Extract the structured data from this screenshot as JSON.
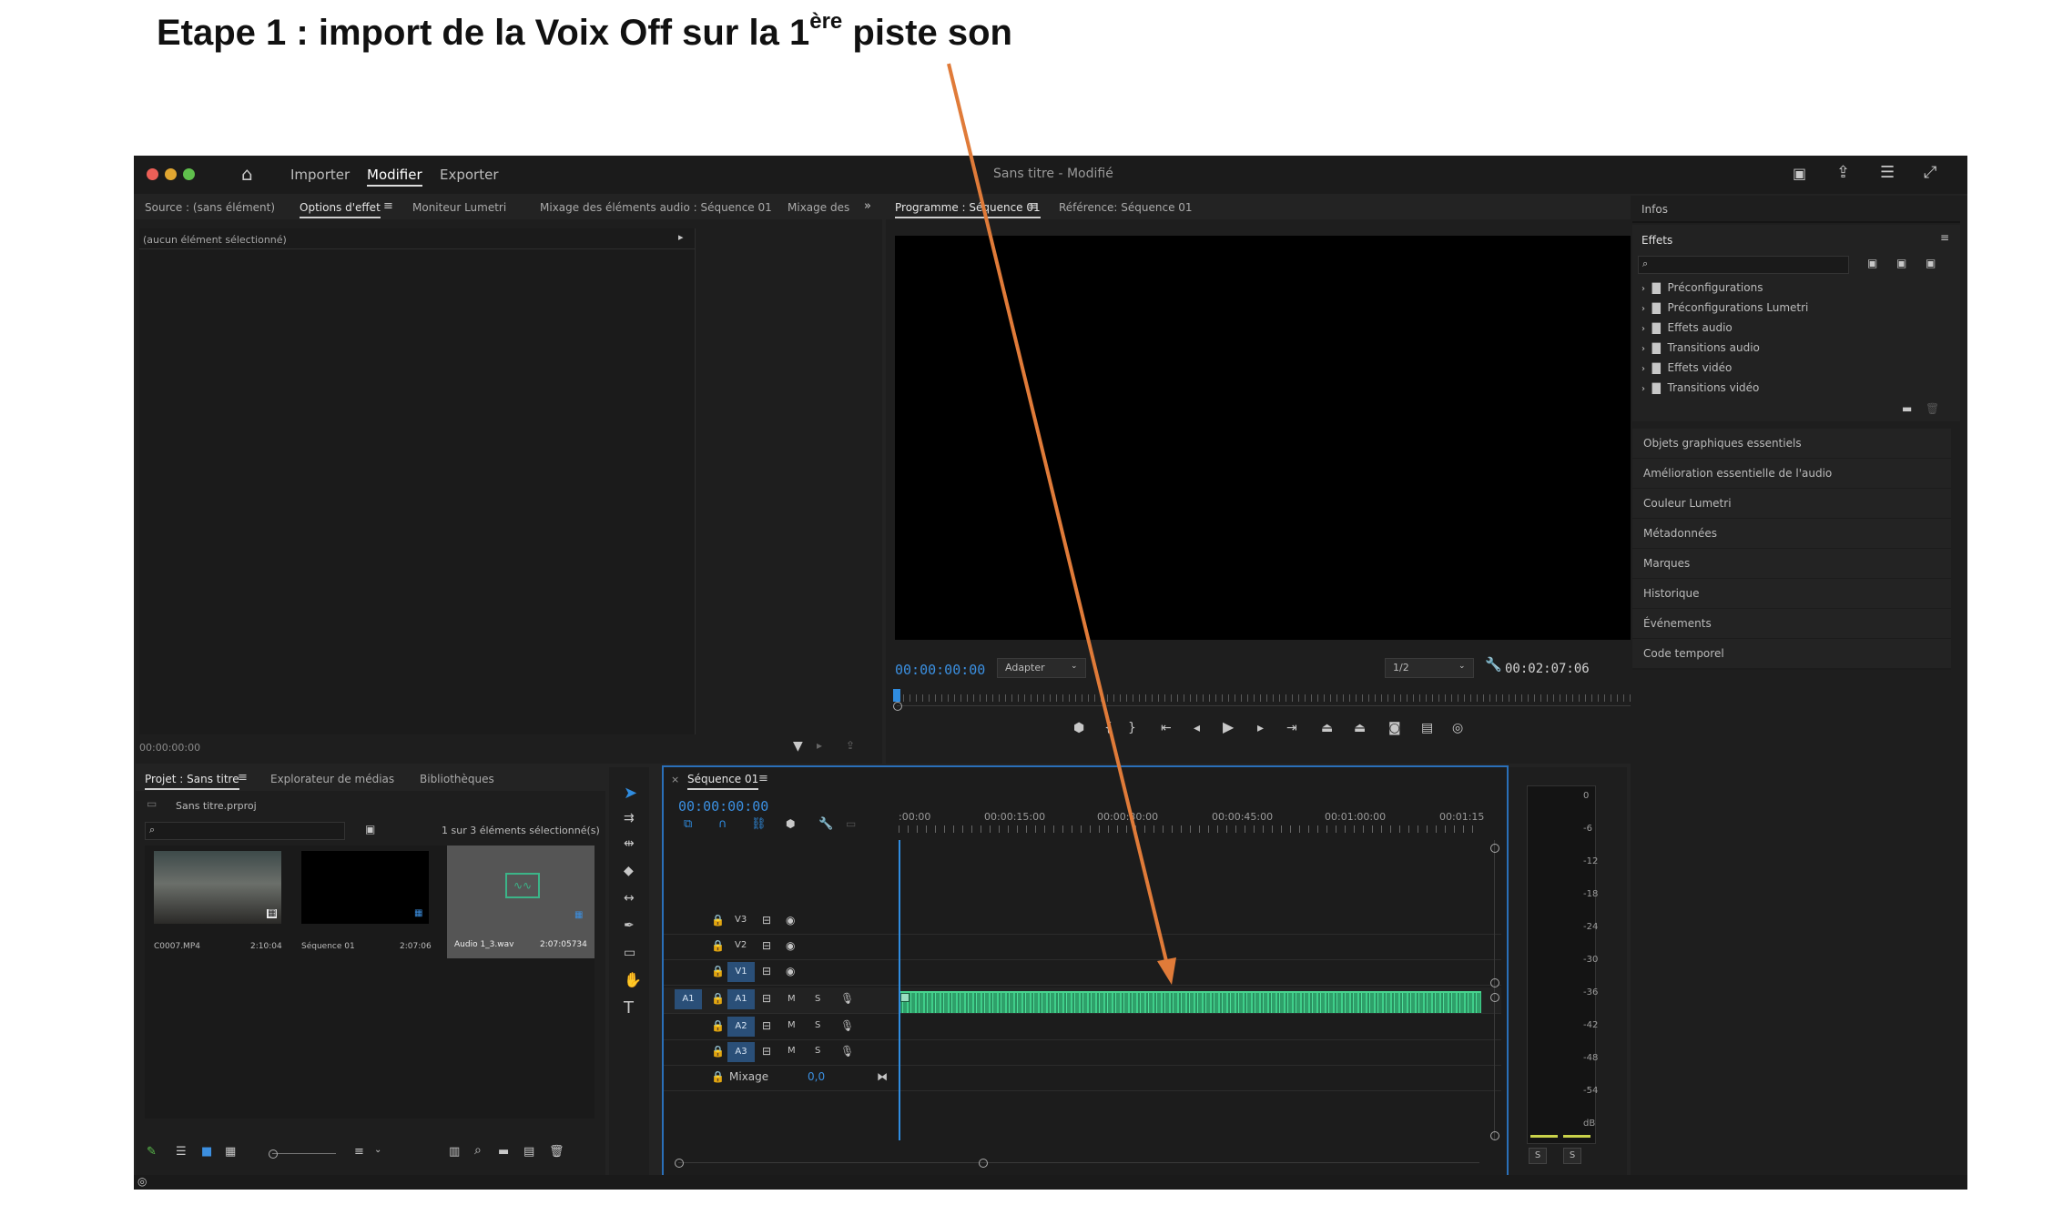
{
  "heading": {
    "prefix": "Etape 1 : import de la Voix Off sur la 1",
    "sup": "ère",
    "suffix": " piste son"
  },
  "titlebar": {
    "menu": [
      "Importer",
      "Modifier",
      "Exporter"
    ],
    "title": "Sans titre - Modifié"
  },
  "source_panel": {
    "tabs": [
      "Source : (sans élément)",
      "Options d'effet",
      "Moniteur Lumetri",
      "Mixage des éléments audio : Séquence 01",
      "Mixage des"
    ],
    "no_selection": "(aucun élément sélectionné)",
    "timecode": "00:00:00:00"
  },
  "program_panel": {
    "tabs": [
      "Programme : Séquence 01",
      "Référence: Séquence 01"
    ],
    "timecode": "00:00:00:00",
    "fit_select": "Adapter",
    "resolution_select": "1/2",
    "duration": "00:02:07:06"
  },
  "right_panel": {
    "infos": "Infos",
    "effects_title": "Effets",
    "effects_folders": [
      "Préconfigurations",
      "Préconfigurations Lumetri",
      "Effets audio",
      "Transitions audio",
      "Effets vidéo",
      "Transitions vidéo"
    ],
    "sections": [
      "Objets graphiques essentiels",
      "Amélioration essentielle de l'audio",
      "Couleur Lumetri",
      "Métadonnées",
      "Marques",
      "Historique",
      "Événements",
      "Code temporel"
    ]
  },
  "project_panel": {
    "tabs": [
      "Projet : Sans titre",
      "Explorateur de médias",
      "Bibliothèques"
    ],
    "file": "Sans titre.prproj",
    "selection_count": "1 sur 3 éléments sélectionné(s)",
    "items": [
      {
        "name": "C0007.MP4",
        "duration": "2:10:04"
      },
      {
        "name": "Séquence 01",
        "duration": "2:07:06"
      },
      {
        "name": "Audio 1_3.wav",
        "duration": "2:07:05734"
      }
    ]
  },
  "timeline": {
    "tab": "Séquence 01",
    "timecode": "00:00:00:00",
    "ruler": [
      ":00:00",
      "00:00:15:00",
      "00:00:30:00",
      "00:00:45:00",
      "00:01:00:00",
      "00:01:15"
    ],
    "video_tracks": [
      "V3",
      "V2",
      "V1"
    ],
    "audio_tracks": [
      "A1",
      "A2",
      "A3"
    ],
    "source_patch": "A1",
    "track_labels": {
      "mute": "M",
      "solo": "S"
    },
    "mix_label": "Mixage",
    "mix_value": "0,0"
  },
  "audio_meter": {
    "scale": [
      "0",
      "-6",
      "-12",
      "-18",
      "-24",
      "-30",
      "-36",
      "-42",
      "-48",
      "-54",
      "dB"
    ],
    "solo_buttons": [
      "S",
      "S"
    ]
  },
  "colors": {
    "accent": "#2f8ce0",
    "audio_clip": "#2fa06a",
    "arrow": "#e07b39"
  }
}
